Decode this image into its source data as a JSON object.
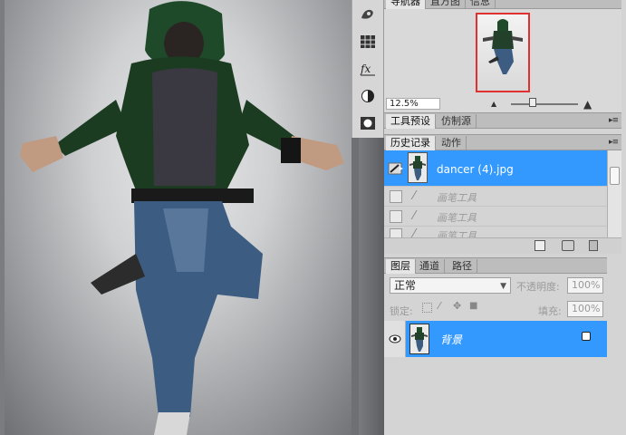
{
  "navigator": {
    "tabs": [
      "导航器",
      "直方图",
      "信息"
    ],
    "zoom_value": "12.5%"
  },
  "tool_presets": {
    "tabs": [
      "工具预设",
      "仿制源"
    ]
  },
  "history": {
    "tabs": [
      "历史记录",
      "动作"
    ],
    "snapshot_label": "dancer (4).jpg",
    "steps": [
      "画笔工具",
      "画笔工具",
      "画笔工具"
    ]
  },
  "layers": {
    "tabs": [
      "图层",
      "通道",
      "路径"
    ],
    "blend_mode": "正常",
    "opacity_label": "不透明度:",
    "opacity_value": "100%",
    "lock_label": "锁定:",
    "fill_label": "填充:",
    "fill_value": "100%",
    "layer_name": "背景"
  },
  "tools": {
    "icons": [
      "brush-presets-icon",
      "grid-icon",
      "fx-icon",
      "adjustment-icon",
      "mask-icon"
    ]
  },
  "colors": {
    "selection": "#3399ff",
    "thumb_border": "#e03030"
  }
}
